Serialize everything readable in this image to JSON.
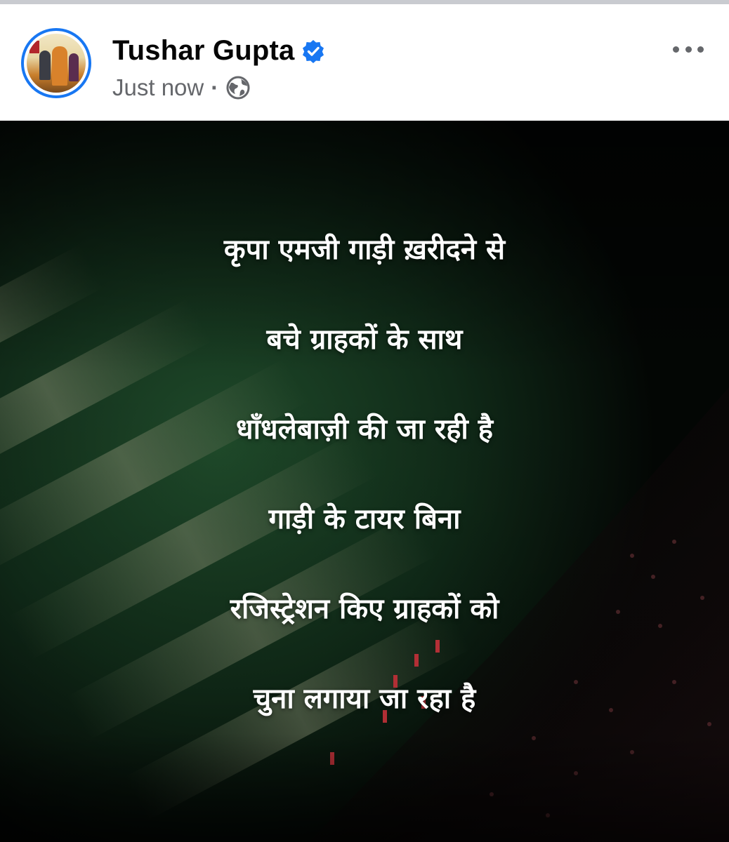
{
  "post": {
    "author": "Tushar Gupta",
    "timestamp": "Just now",
    "separator": "·",
    "privacy_icon": "globe-icon",
    "verified_icon": "verified-badge-icon",
    "more_icon": "more-options-icon"
  },
  "image_text": {
    "lines": [
      "कृपा एमजी गाड़ी ख़रीदने से",
      "बचे ग्राहकों के साथ",
      "धाँधलेबाज़ी की जा रही है",
      "गाड़ी के टायर बिना",
      "रजिस्ट्रेशन किए ग्राहकों को",
      "चुना लगाया जा रहा है"
    ]
  },
  "colors": {
    "accent": "#1877f2",
    "author_text": "#050505",
    "meta_text": "#65676b",
    "image_text": "#ffffff"
  }
}
